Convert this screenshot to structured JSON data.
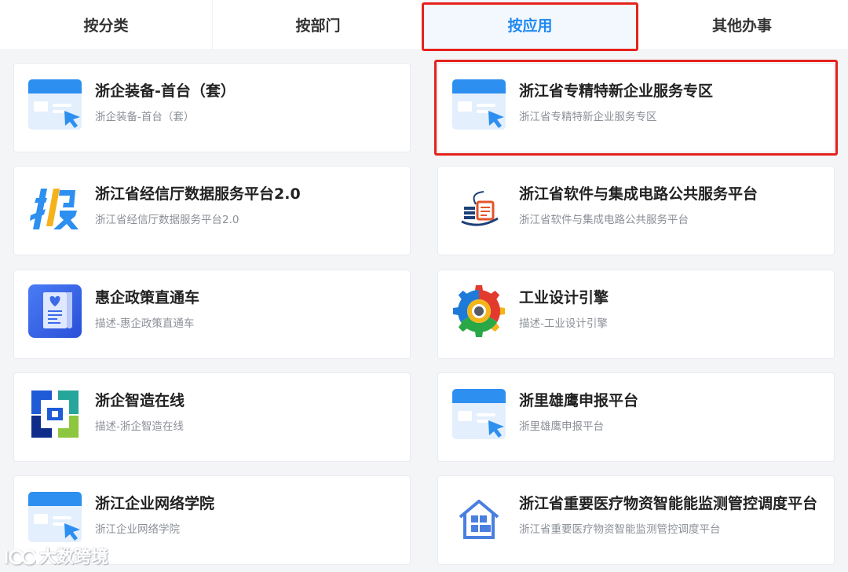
{
  "tabs": [
    {
      "label": "按分类"
    },
    {
      "label": "按部门"
    },
    {
      "label": "按应用",
      "active": true
    },
    {
      "label": "其他办事"
    }
  ],
  "colors": {
    "accent": "#1f88f0",
    "highlight": "#e6221b"
  },
  "cards": [
    {
      "title": "浙企装备-首台（套）",
      "desc": "浙企装备-首台（套）",
      "icon": "app-window-icon"
    },
    {
      "title": "浙江省专精特新企业服务专区",
      "desc": "浙江省专精特新企业服务专区",
      "icon": "app-window-icon",
      "highlighted": true
    },
    {
      "title": "浙江省经信厅数据服务平台2.0",
      "desc": "浙江省经信厅数据服务平台2.0",
      "icon": "bao-report-icon"
    },
    {
      "title": "浙江省软件与集成电路公共服务平台",
      "desc": "浙江省软件与集成电路公共服务平台",
      "icon": "software-platform-logo-icon"
    },
    {
      "title": "惠企政策直通车",
      "desc": "描述-惠企政策直通车",
      "icon": "policy-document-icon"
    },
    {
      "title": "工业设计引擎",
      "desc": "描述-工业设计引擎",
      "icon": "gear-logo-icon"
    },
    {
      "title": "浙企智造在线",
      "desc": "描述-浙企智造在线",
      "icon": "smart-manufacturing-logo-icon"
    },
    {
      "title": "浙里雄鹰申报平台",
      "desc": "浙里雄鹰申报平台",
      "icon": "app-window-icon"
    },
    {
      "title": "浙江企业网络学院",
      "desc": "浙江企业网络学院",
      "icon": "app-window-icon"
    },
    {
      "title": "浙江省重要医疗物资智能能监测管控调度平台",
      "desc": "浙江省重要医疗物资智能监测管控调度平台",
      "icon": "warehouse-icon"
    }
  ],
  "watermark": {
    "text": "大数跨境"
  }
}
